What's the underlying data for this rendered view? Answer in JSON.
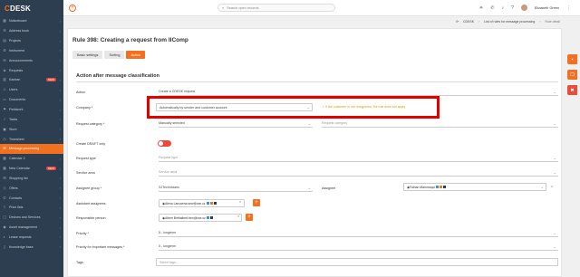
{
  "app": {
    "logo_c": "C",
    "logo_rest": "DESK",
    "brand_color": "#f37021"
  },
  "sidebar": {
    "items": [
      {
        "label": "Noticeboard",
        "icon": "board-icon"
      },
      {
        "label": "Address book",
        "icon": "contacts-icon"
      },
      {
        "label": "Projects",
        "icon": "projects-icon"
      },
      {
        "label": "Instrument",
        "icon": "instrument-icon"
      },
      {
        "label": "Announcements",
        "icon": "megaphone-icon"
      },
      {
        "label": "Requests",
        "icon": "requests-icon"
      },
      {
        "label": "Kanban",
        "icon": "kanban-icon",
        "badge": "NEW"
      },
      {
        "label": "Users",
        "icon": "users-icon"
      },
      {
        "label": "Documents",
        "icon": "documents-icon"
      },
      {
        "label": "Fieldwork",
        "icon": "fieldwork-icon"
      },
      {
        "label": "Tasks",
        "icon": "tasks-icon"
      },
      {
        "label": "Store",
        "icon": "store-icon"
      },
      {
        "label": "Timesheet",
        "icon": "timesheet-icon"
      },
      {
        "label": "Message processing",
        "icon": "mail-icon",
        "active": true
      },
      {
        "label": "Calendar 2",
        "icon": "calendar-icon"
      },
      {
        "label": "New Calendar",
        "icon": "calendar-icon",
        "badge": "NEW"
      },
      {
        "label": "Shopping list",
        "icon": "cart-icon"
      },
      {
        "label": "Offers",
        "icon": "offers-icon"
      },
      {
        "label": "Contacts",
        "icon": "phone-icon"
      },
      {
        "label": "Price lists",
        "icon": "pricelist-icon"
      },
      {
        "label": "Devices and Services",
        "icon": "devices-icon"
      },
      {
        "label": "Asset management",
        "icon": "asset-icon"
      },
      {
        "label": "Lease requests",
        "icon": "lease-icon"
      },
      {
        "label": "Knowledge base",
        "icon": "book-icon"
      }
    ]
  },
  "topbar": {
    "search_placeholder": "Search open records",
    "user_name": "Elizabeth Green"
  },
  "breadcrumb": {
    "items": [
      "CDESK",
      "List of rules for message processing",
      "Rule detail"
    ]
  },
  "page": {
    "title": "Rule 398: Creating a request from IIComp",
    "tabs": [
      "Basic settings",
      "Sorting",
      "Action"
    ],
    "section_title": "Action after message classification"
  },
  "form": {
    "action_label": "Action",
    "action_value": "Create a CDESK request",
    "company_label": "Company",
    "company_value": "Automatically by sender and customer account",
    "company_warning": "If the customer is not recognized, the rule does not apply.",
    "request_category_label": "Request category",
    "request_category_value": "Manually selected",
    "request_category_placeholder": "Request category",
    "draft_label": "Create DRAFT only",
    "request_type_label": "Request type",
    "request_type_placeholder": "Request type",
    "service_area_label": "Service area",
    "service_area_placeholder": "Service area",
    "assignee_group_label": "Assignee group",
    "assignee_group_value": "SJTechnicians",
    "assignee_label": "Assignee",
    "assignee_value": "Fabian Mammoqui",
    "assistant_label": "Assistant assignees",
    "assistant_value": "Alena Lancaena.sew@cse.cz",
    "responsible_label": "Responsible person",
    "responsible_value": "Albert Birthalbert.ben@cse.cz",
    "priority_label": "Priority",
    "priority_value": "5 - longterm",
    "priority_important_label": "Priority for important messages",
    "priority_important_value": "5 - longterm",
    "tags_label": "Tags",
    "tags_placeholder": "Select tags..."
  },
  "colors": {
    "highlight": "#e50000",
    "toggle": "#e74c3c",
    "sidebar": "#2c3e50"
  }
}
